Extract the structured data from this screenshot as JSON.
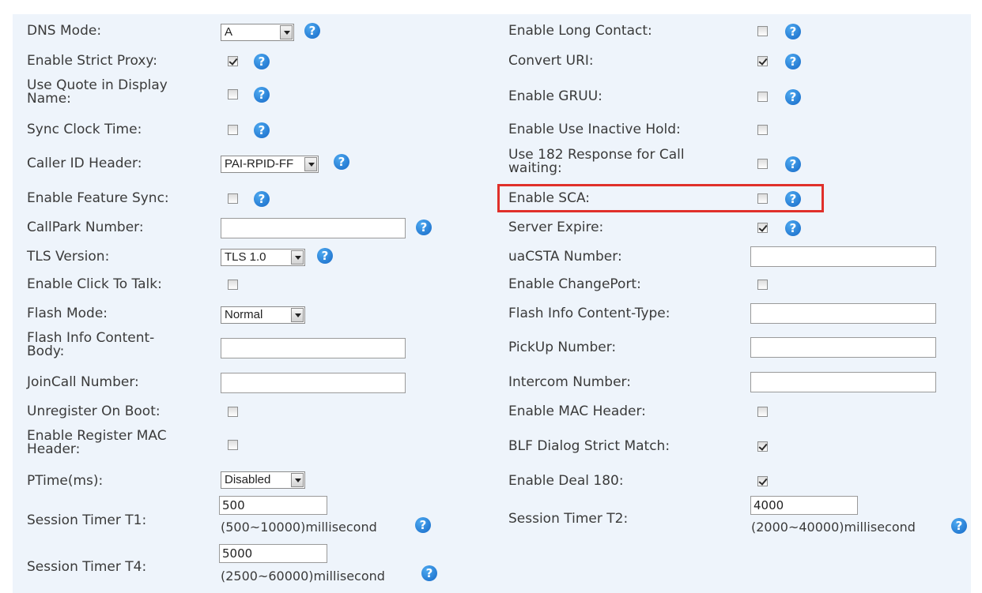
{
  "left": {
    "dns_mode": {
      "label": "DNS Mode:",
      "value": "A"
    },
    "strict_proxy": {
      "label": "Enable Strict Proxy:",
      "checked": true
    },
    "quote_display": {
      "label": "Use Quote in Display Name:",
      "checked": false
    },
    "sync_clock": {
      "label": "Sync Clock Time:",
      "checked": false
    },
    "caller_id": {
      "label": "Caller ID Header:",
      "value": "PAI-RPID-FF"
    },
    "feature_sync": {
      "label": "Enable Feature Sync:",
      "checked": false
    },
    "callpark": {
      "label": "CallPark Number:",
      "value": ""
    },
    "tls_version": {
      "label": "TLS Version:",
      "value": "TLS 1.0"
    },
    "click_to_talk": {
      "label": "Enable Click To Talk:",
      "checked": false
    },
    "flash_mode": {
      "label": "Flash Mode:",
      "value": "Normal"
    },
    "flash_body": {
      "label": "Flash Info Content-Body:",
      "value": ""
    },
    "joincall": {
      "label": "JoinCall Number:",
      "value": ""
    },
    "unregister_boot": {
      "label": "Unregister On Boot:",
      "checked": false
    },
    "register_mac": {
      "label": "Enable Register MAC Header:",
      "checked": false
    },
    "ptime": {
      "label": "PTime(ms):",
      "value": "Disabled"
    },
    "timer_t1": {
      "label": "Session Timer T1:",
      "value": "500",
      "hint": "(500~10000)millisecond"
    },
    "timer_t4": {
      "label": "Session Timer T4:",
      "value": "5000",
      "hint": "(2500~60000)millisecond"
    }
  },
  "right": {
    "long_contact": {
      "label": "Enable Long Contact:",
      "checked": false
    },
    "convert_uri": {
      "label": "Convert URI:",
      "checked": true
    },
    "gruu": {
      "label": "Enable GRUU:",
      "checked": false
    },
    "inactive_hold": {
      "label": "Enable Use Inactive Hold:",
      "checked": false
    },
    "resp182": {
      "label": "Use 182 Response for Call waiting:",
      "checked": false
    },
    "sca": {
      "label": "Enable SCA:",
      "checked": false
    },
    "server_expire": {
      "label": "Server Expire:",
      "checked": true
    },
    "uacsta": {
      "label": "uaCSTA Number:",
      "value": ""
    },
    "changeport": {
      "label": "Enable ChangePort:",
      "checked": false
    },
    "flash_ctype": {
      "label": "Flash Info Content-Type:",
      "value": ""
    },
    "pickup": {
      "label": "PickUp Number:",
      "value": ""
    },
    "intercom": {
      "label": "Intercom Number:",
      "value": ""
    },
    "mac_header": {
      "label": "Enable MAC Header:",
      "checked": false
    },
    "blf_strict": {
      "label": "BLF Dialog Strict Match:",
      "checked": true
    },
    "deal180": {
      "label": "Enable Deal 180:",
      "checked": true
    },
    "timer_t2": {
      "label": "Session Timer T2:",
      "value": "4000",
      "hint": "(2000~40000)millisecond"
    }
  },
  "help_glyph": "?",
  "colors": {
    "background": "#eef4fb",
    "help": "#1f7ad6",
    "highlight": "#e0302a"
  }
}
